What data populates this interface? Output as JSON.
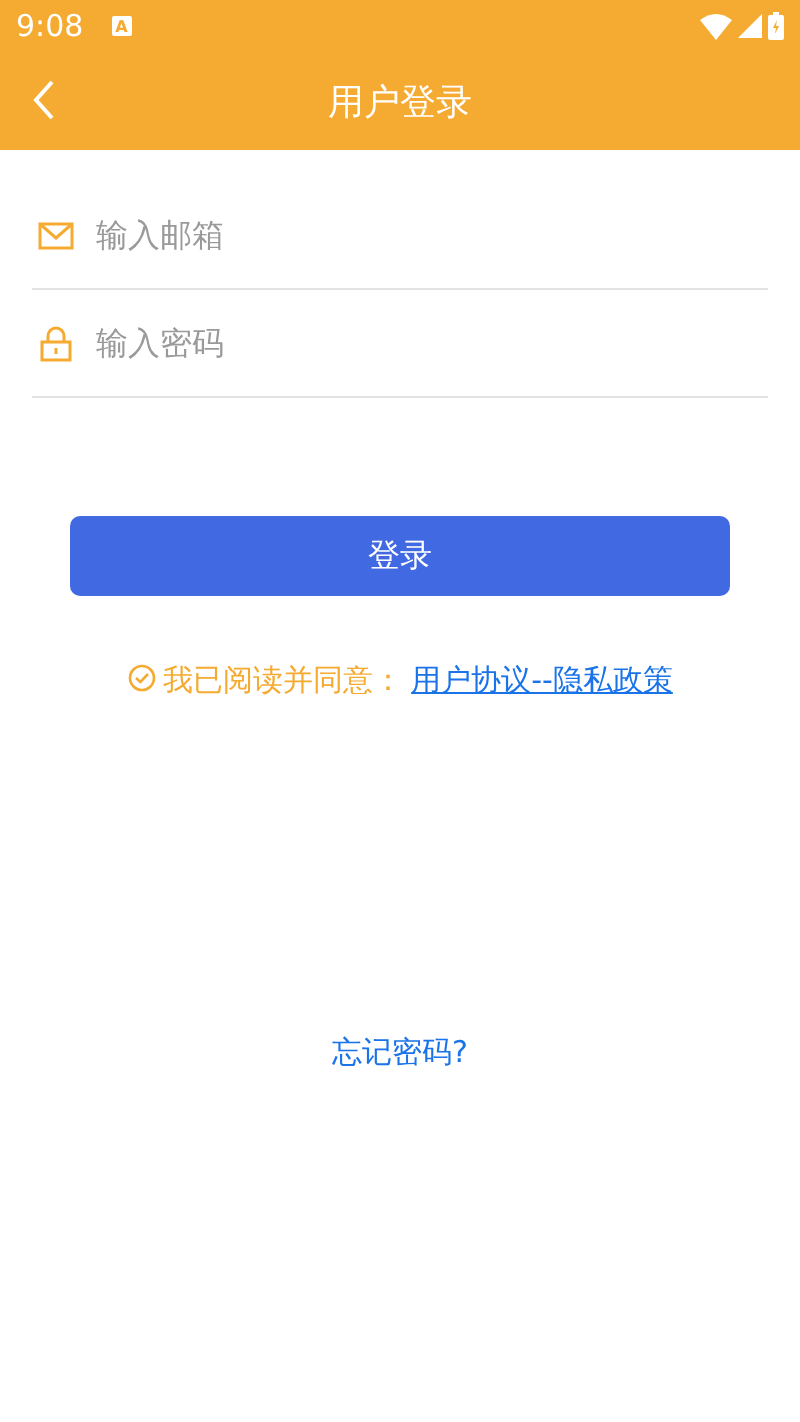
{
  "status_bar": {
    "time": "9:08",
    "notification": "A"
  },
  "header": {
    "title": "用户登录"
  },
  "fields": [
    {
      "kind": "email",
      "placeholder": "输入邮箱"
    },
    {
      "kind": "password",
      "placeholder": "输入密码"
    }
  ],
  "login_button": "登录",
  "agreement": {
    "checked": true,
    "text": "我已阅读并同意：",
    "link": "用户协议--隐私政策"
  },
  "forgot_link": "忘记密码?"
}
